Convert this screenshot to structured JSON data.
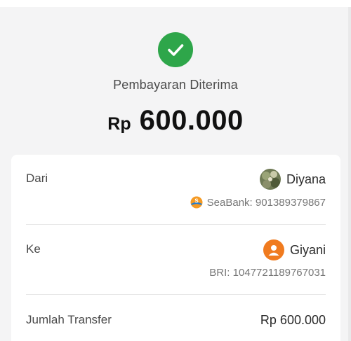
{
  "status": {
    "title": "Pembayaran Diterima",
    "icon": "check-circle-icon",
    "color": "#2ea64a"
  },
  "amount": {
    "currency": "Rp",
    "value": "600.000"
  },
  "details": {
    "from": {
      "label": "Dari",
      "name": "Diyana",
      "account": "SeaBank: 901389379867",
      "bank_icon": "seabank-logo-icon"
    },
    "to": {
      "label": "Ke",
      "name": "Giyani",
      "account": "BRI: 1047721189767031",
      "avatar_color": "#f07b1f"
    },
    "total": {
      "label": "Jumlah Transfer",
      "value": "Rp 600.000"
    }
  }
}
